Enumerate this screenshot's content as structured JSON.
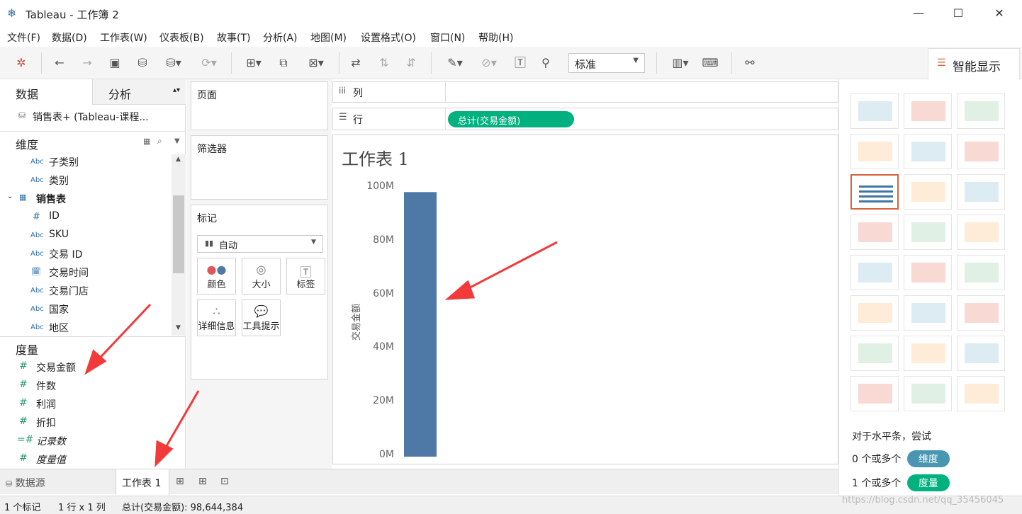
{
  "app": {
    "title": "Tableau - 工作簿 2"
  },
  "menu": [
    "文件(F)",
    "数据(D)",
    "工作表(W)",
    "仪表板(B)",
    "故事(T)",
    "分析(A)",
    "地图(M)",
    "设置格式(O)",
    "窗口(N)",
    "帮助(H)"
  ],
  "toolbar": {
    "fit_mode": "标准",
    "show_me": "智能显示"
  },
  "left_panel": {
    "tabs": [
      "数据",
      "分析"
    ],
    "datasource": "销售表+ (Tableau-课程...",
    "dimensions_label": "维度",
    "dimensions": [
      {
        "type": "Abc",
        "name": "子类别"
      },
      {
        "type": "Abc",
        "name": "类别"
      },
      {
        "type": "table",
        "name": "销售表"
      },
      {
        "type": "#",
        "name": "ID"
      },
      {
        "type": "Abc",
        "name": "SKU"
      },
      {
        "type": "Abc",
        "name": "交易 ID"
      },
      {
        "type": "date",
        "name": "交易时间"
      },
      {
        "type": "Abc",
        "name": "交易门店"
      },
      {
        "type": "Abc",
        "name": "国家"
      },
      {
        "type": "Abc",
        "name": "地区"
      }
    ],
    "measures_label": "度量",
    "measures": [
      "交易金额",
      "件数",
      "利润",
      "折扣",
      "记录数",
      "度量值"
    ]
  },
  "shelves": {
    "pages": "页面",
    "filters": "筛选器",
    "marks": "标记",
    "mark_type": "自动",
    "mark_buttons": [
      "颜色",
      "大小",
      "标签",
      "详细信息",
      "工具提示"
    ],
    "columns": "列",
    "rows": "行",
    "row_pill": "总计(交易金额)"
  },
  "colors": {
    "bar": "#4e79a7",
    "measure_pill": "#00b180",
    "dimension_pill": "#4996b2",
    "selected_thumb": "#d9623b"
  },
  "chart_data": {
    "type": "bar",
    "title": "工作表 1",
    "ylabel": "交易金额",
    "yticks": [
      "100M",
      "80M",
      "60M",
      "40M",
      "20M",
      "0M"
    ],
    "values": [
      98644384
    ],
    "ylim": [
      0,
      104000000
    ]
  },
  "show_me": {
    "hint": "对于水平条，尝试",
    "req1_text": "0 个或多个",
    "req1_pill": "维度",
    "req2_text": "1 个或多个",
    "req2_pill": "度量"
  },
  "bottom_tabs": {
    "datasource": "数据源",
    "sheet": "工作表 1"
  },
  "status": {
    "marks": "1 个标记",
    "grid": "1 行 x 1 列",
    "sum": "总计(交易金额): 98,644,384",
    "watermark": "https://blog.csdn.net/qq_35456045"
  }
}
